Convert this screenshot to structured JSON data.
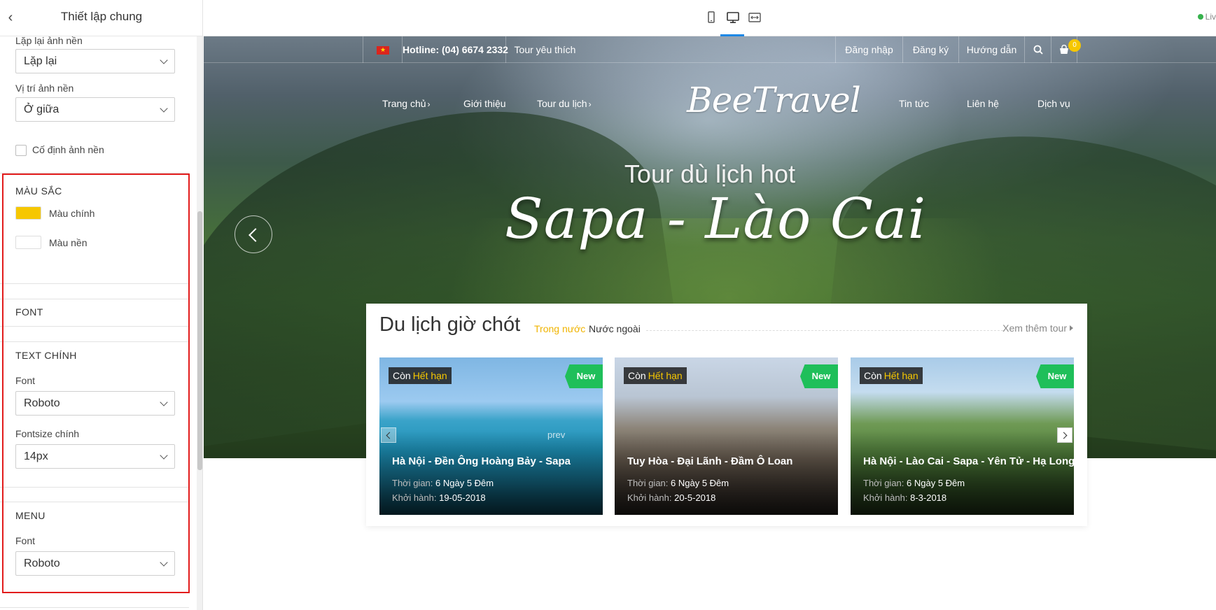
{
  "panel": {
    "title": "Thiết lập chung",
    "background": {
      "repeat_label": "Lặp lại ảnh nền",
      "repeat_value": "Lặp lại",
      "position_label": "Vị trí ảnh nền",
      "position_value": "Ở giữa",
      "fixed_label": "Cố định ảnh nền",
      "fixed_checked": false
    },
    "colors": {
      "heading": "MÀU SẮC",
      "primary_label": "Màu chính",
      "primary_color": "#f6c700",
      "background_label": "Màu nền",
      "background_color": "#ffffff"
    },
    "font": {
      "heading": "FONT"
    },
    "main_text": {
      "heading": "TEXT CHÍNH",
      "font_label": "Font",
      "font_value": "Roboto",
      "size_label": "Fontsize chính",
      "size_value": "14px"
    },
    "menu": {
      "heading": "MENU",
      "font_label": "Font",
      "font_value": "Roboto"
    },
    "highlight_color": "#e21c1c"
  },
  "toolbar": {
    "devices": [
      "mobile-icon",
      "desktop-icon",
      "fullwidth-icon"
    ],
    "active_device": "desktop-icon",
    "live_label": "Liv"
  },
  "site": {
    "topbar": {
      "hotline": "Hotline: (04) 6674 2332",
      "favorite": "Tour yêu thích",
      "login": "Đăng nhập",
      "register": "Đăng ký",
      "guide": "Hướng dẫn",
      "cart_count": "0"
    },
    "nav": {
      "home": "Trang chủ",
      "about": "Giới thiệu",
      "tours": "Tour du lịch",
      "logo": "BeeTravel",
      "news": "Tin tức",
      "contact": "Liên hệ",
      "services": "Dịch vụ"
    },
    "hero": {
      "subtitle": "Tour dù lịch hot",
      "title": "Sapa - Lào Cai"
    },
    "deals": {
      "title": "Du lịch giờ chót",
      "tab_domestic": "Trong nước",
      "tab_foreign": "Nước ngoài",
      "more": "Xem thêm tour",
      "status_prefix": "Còn",
      "status_value": "Hết hạn",
      "new_label": "New",
      "time_label": "Thời gian:",
      "depart_label": "Khởi hành:",
      "prev_text": "prev",
      "cards": [
        {
          "name": "Hà Nội - Đền Ông Hoàng Bảy - Sapa",
          "duration": "6 Ngày 5 Đêm",
          "depart": "19-05-2018"
        },
        {
          "name": "Tuy Hòa - Đại Lãnh - Đầm Ô Loan",
          "duration": "6 Ngày 5 Đêm",
          "depart": "20-5-2018"
        },
        {
          "name": "Hà Nội - Lào Cai - Sapa - Yên Tử - Hạ Long",
          "duration": "6 Ngày 5 Đêm",
          "depart": "8-3-2018"
        }
      ]
    }
  }
}
